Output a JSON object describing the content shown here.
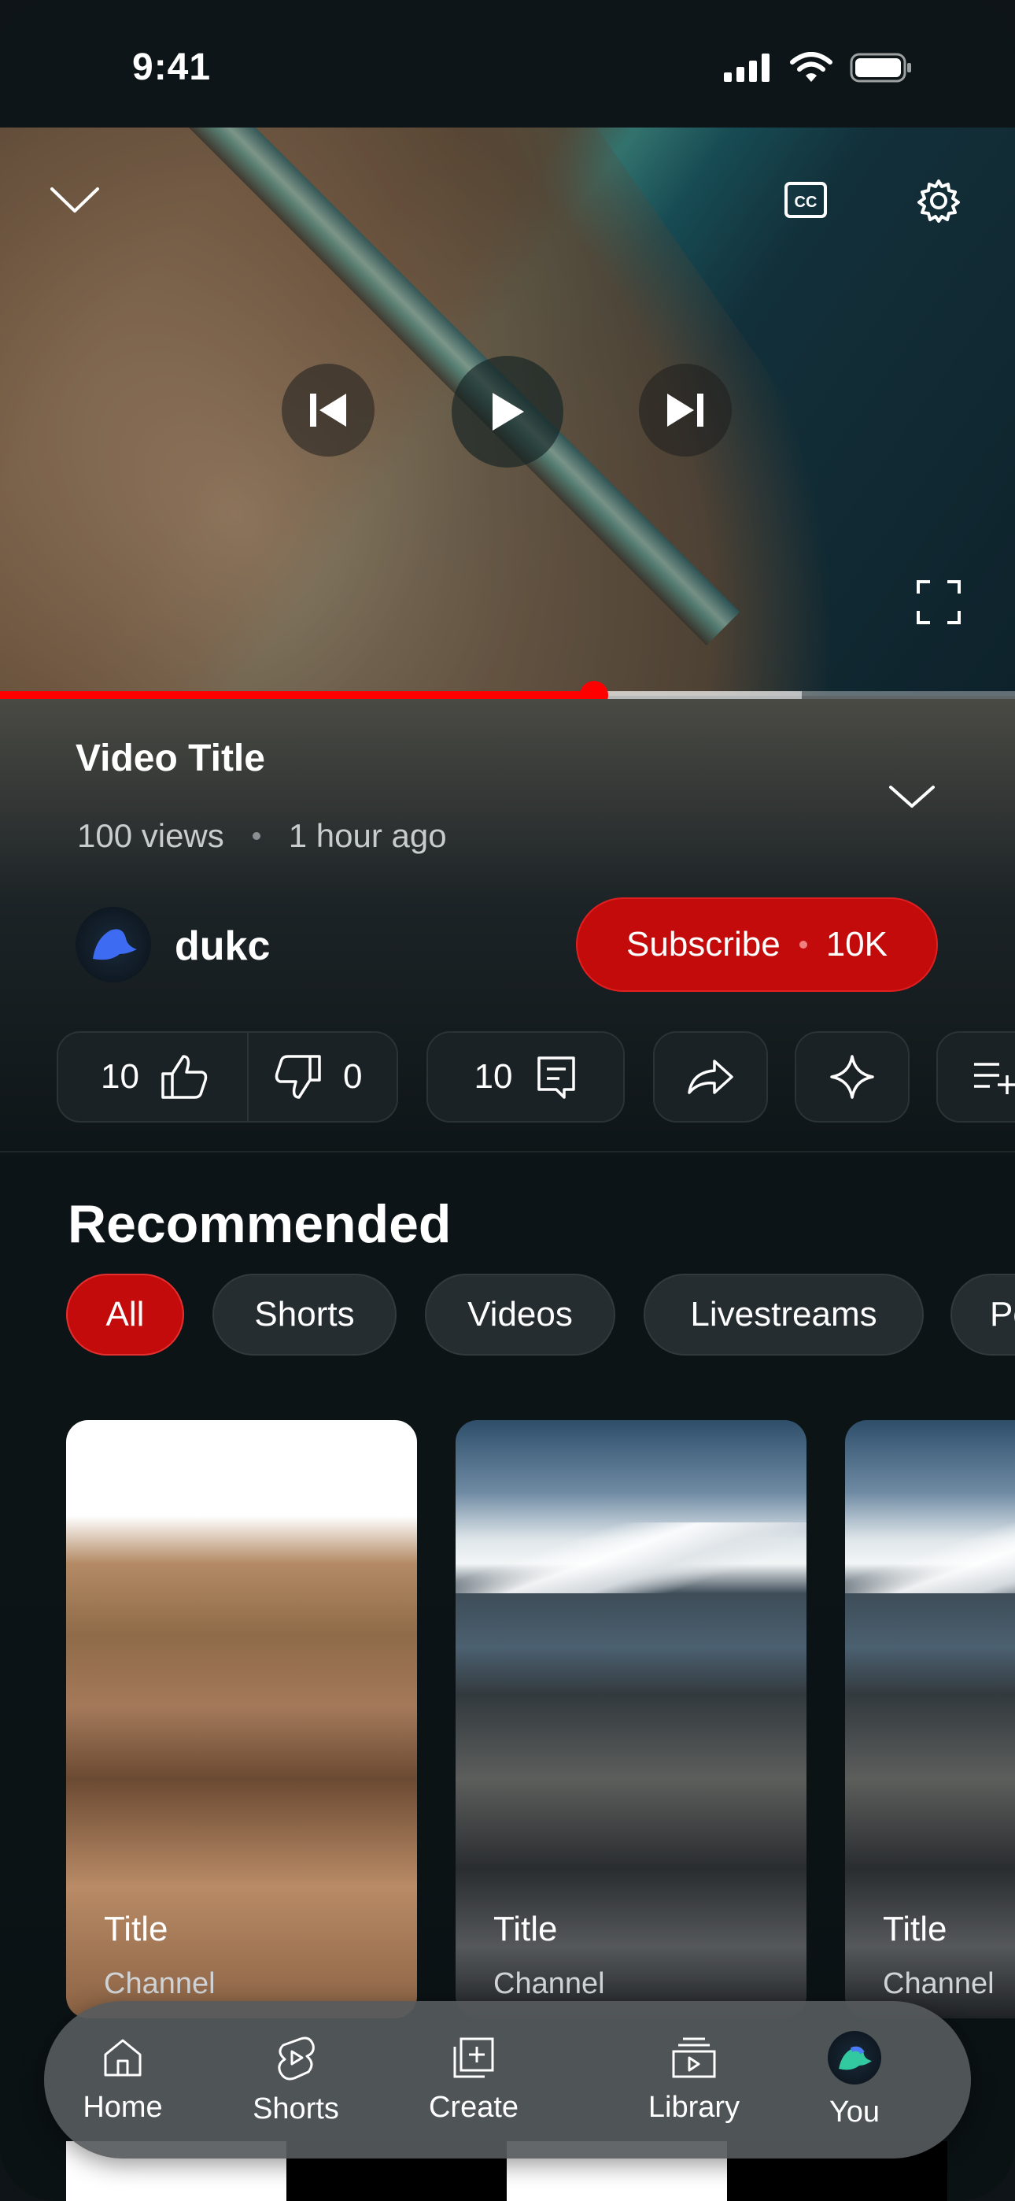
{
  "status_bar": {
    "time": "9:41"
  },
  "player": {
    "progress_played": 0.585,
    "progress_buffered": 0.79
  },
  "video": {
    "title": "Video Title",
    "views": "100 views",
    "age": "1 hour ago"
  },
  "channel": {
    "name": "dukc",
    "subscribe_label": "Subscribe",
    "subscriber_count": "10K"
  },
  "actions": {
    "likes": "10",
    "dislikes": "0",
    "comments": "10"
  },
  "recommended": {
    "heading": "Recommended",
    "chips": [
      "All",
      "Shorts",
      "Videos",
      "Livestreams",
      "Podcasts"
    ],
    "cards": [
      {
        "title": "Title",
        "channel": "Channel"
      },
      {
        "title": "Title",
        "channel": "Channel"
      },
      {
        "title": "Title",
        "channel": "Channel"
      }
    ]
  },
  "tab_bar": {
    "items": [
      {
        "label": "Home",
        "icon": "home-icon"
      },
      {
        "label": "Shorts",
        "icon": "shorts-icon"
      },
      {
        "label": "Create",
        "icon": "create-icon"
      },
      {
        "label": "Library",
        "icon": "library-icon"
      },
      {
        "label": "You",
        "icon": "avatar"
      }
    ]
  },
  "colors": {
    "accent": "#ff0000",
    "subscribe": "#c40b0b",
    "background": "#0e1417"
  }
}
